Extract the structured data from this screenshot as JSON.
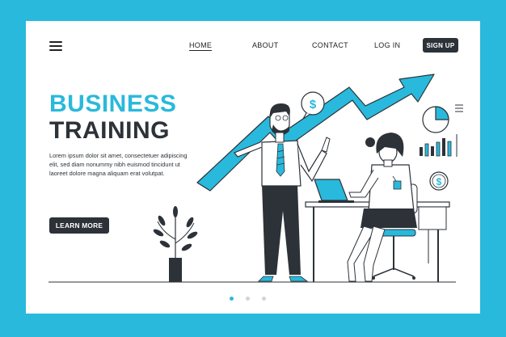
{
  "nav": {
    "home": "HOME",
    "about": "ABOUT",
    "contact": "CONTACT",
    "login": "LOG IN",
    "signup": "SIGN UP"
  },
  "hero": {
    "title_line1": "BUSINESS",
    "title_line2": "TRAINING",
    "description": "Lorem ipsum dolor sit amet, consectetuer adipiscing elit, sed diam nonummy nibh euismod tincidunt ut laoreet dolore magna aliquam erat volutpat.",
    "cta": "LEARN MORE"
  },
  "illustration": {
    "dollar_symbol": "$",
    "accent_color": "#29b9dc",
    "dark_color": "#2c3238"
  },
  "carousel": {
    "slide_count": 3,
    "active_slide": 1
  },
  "colors": {
    "background": "#29b9dc",
    "card": "#ffffff",
    "button": "#2c3238"
  }
}
